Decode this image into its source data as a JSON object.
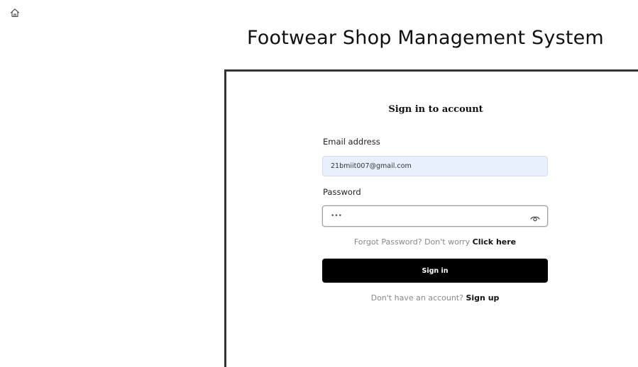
{
  "header": {
    "title": "Footwear Shop Management System",
    "home_icon": "home-icon"
  },
  "form": {
    "heading": "Sign in to account",
    "email": {
      "label": "Email address",
      "value": "21bmiit007@gmail.com"
    },
    "password": {
      "label": "Password",
      "value": "•••",
      "toggle_icon": "eye-icon"
    },
    "forgot": {
      "prefix": "Forgot Password? Don't worry",
      "link": "Click here"
    },
    "submit_label": "Sign in",
    "signup": {
      "prefix": "Don't have an account?",
      "link": "Sign up"
    }
  },
  "colors": {
    "button_bg": "#000000",
    "email_field_bg": "#e8f0fe",
    "muted_text": "#888888"
  }
}
